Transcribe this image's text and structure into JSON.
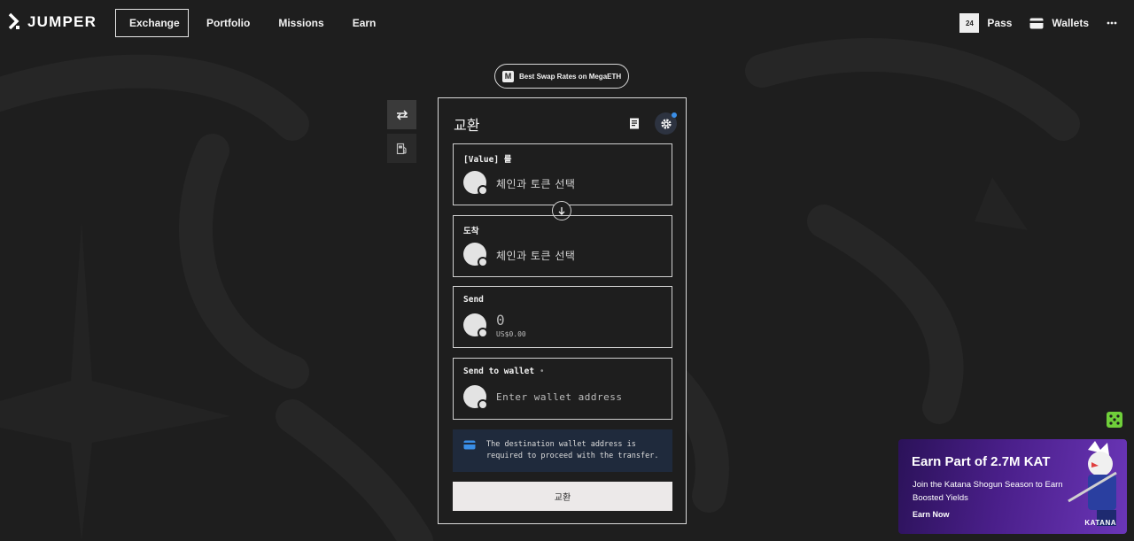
{
  "brand": {
    "logo_text": "JUMPER"
  },
  "nav": {
    "items": [
      {
        "label": "Exchange",
        "active": true
      },
      {
        "label": "Portfolio",
        "active": false
      },
      {
        "label": "Missions",
        "active": false
      },
      {
        "label": "Earn",
        "active": false
      }
    ]
  },
  "header": {
    "pass_badge": "24",
    "pass_label": "Pass",
    "wallets_label": "Wallets",
    "more_icon": "more-horizontal-icon"
  },
  "promo_pill": {
    "icon_letter": "M",
    "text": "Best Swap Rates on MegaETH"
  },
  "side_tools": [
    {
      "icon": "swap-arrows-icon",
      "active": true
    },
    {
      "icon": "gas-station-icon",
      "active": false
    }
  ],
  "card": {
    "title": "교환",
    "from": {
      "label": "[Value] 를",
      "placeholder": "체인과 토큰 선택"
    },
    "to": {
      "label": "도착",
      "placeholder": "체인과 토큰 선택"
    },
    "send": {
      "label": "Send",
      "amount": "0",
      "usd": "US$0.00"
    },
    "wallet": {
      "label": "Send to wallet",
      "required_mark": "•",
      "placeholder": "Enter wallet address"
    },
    "info_text": "The destination wallet address is required to proceed with the transfer.",
    "submit_label": "교환"
  },
  "promo_card": {
    "title": "Earn Part of 2.7M KAT",
    "subtitle": "Join the Katana Shogun Season to Earn Boosted Yields",
    "cta": "Earn Now",
    "brand": "KATANA"
  },
  "colors": {
    "background": "#1e1e1e",
    "info_bg": "#1f2a3c",
    "accent_blue": "#3a8ee6",
    "promo_purple": "#4a1f8a",
    "dice_green": "#6fcf3a"
  }
}
